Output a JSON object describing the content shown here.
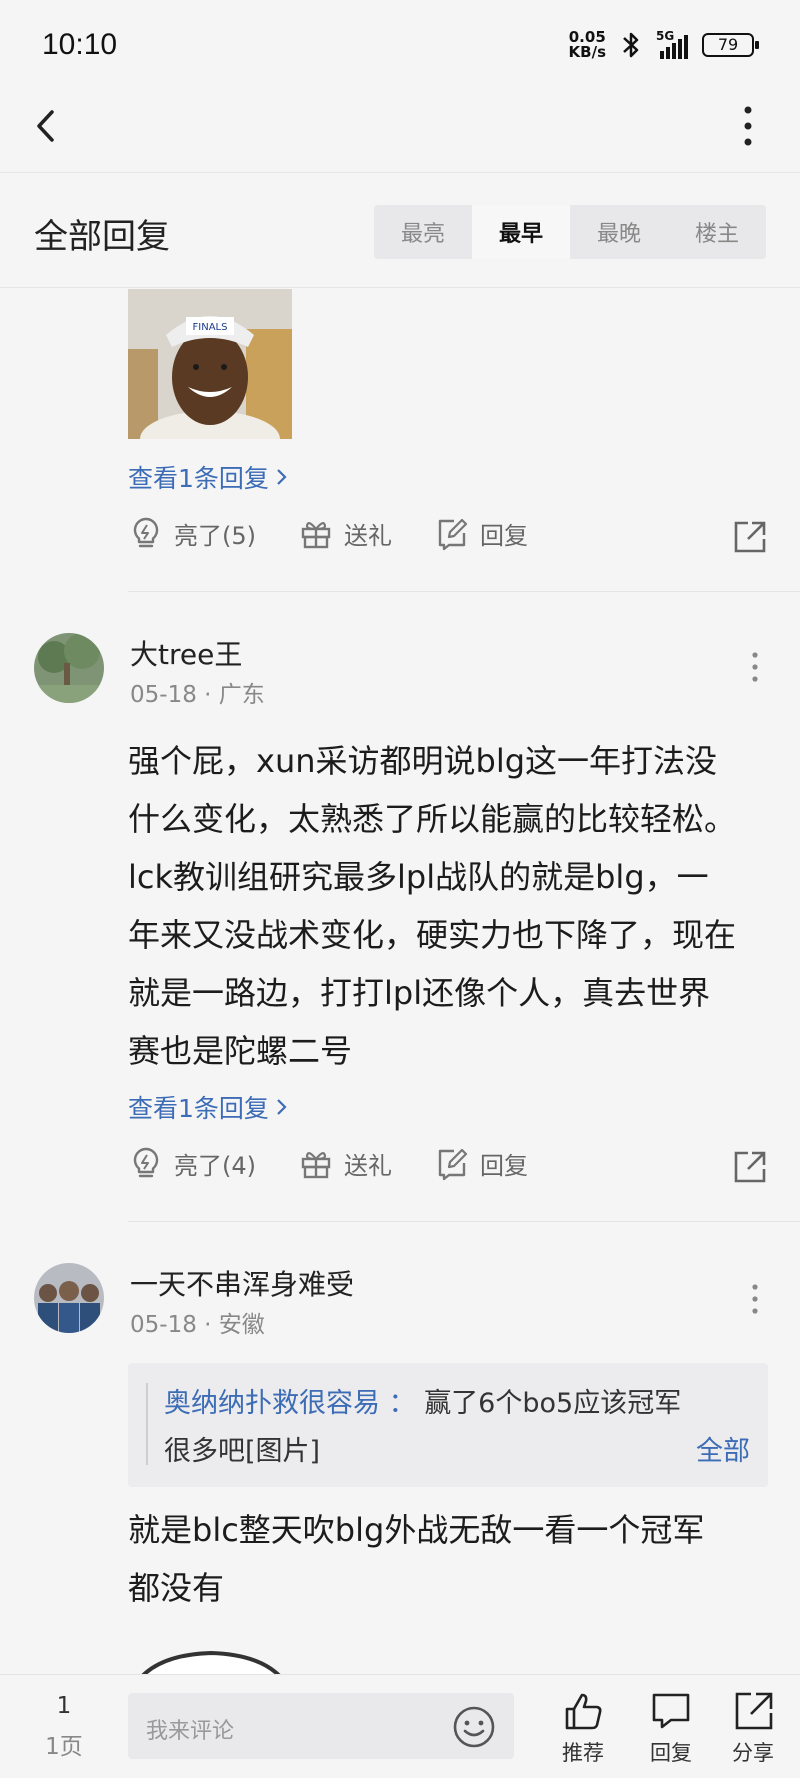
{
  "status_bar": {
    "time": "10:10",
    "net_speed_value": "0.05",
    "net_speed_unit": "KB/s",
    "network": "5G",
    "battery": "79"
  },
  "nav": {
    "back_icon": "chevron-left-icon",
    "more_icon": "more-vertical-icon"
  },
  "replies_header": {
    "title": "全部回复",
    "sort_tabs": [
      {
        "label": "最亮",
        "active": false
      },
      {
        "label": "最早",
        "active": true
      },
      {
        "label": "最晚",
        "active": false
      },
      {
        "label": "楼主",
        "active": false
      }
    ]
  },
  "first_post_tail": {
    "see_replies": "查看1条回复",
    "actions": {
      "like": "亮了(5)",
      "gift": "送礼",
      "reply": "回复"
    }
  },
  "comments": [
    {
      "username": "大tree王",
      "date": "05-18",
      "location": "广东",
      "lines": [
        "强个屁，xun采访都明说blg这一年打法没",
        "什么变化，太熟悉了所以能赢的比较轻松。",
        "lck教训组研究最多lpl战队的就是blg，一",
        "年来又没战术变化，硬实力也下降了，现在",
        "就是一路边，打打lpl还像个人，真去世界",
        "赛也是陀螺二号"
      ],
      "see_replies": "查看1条回复",
      "actions": {
        "like": "亮了(4)",
        "gift": "送礼",
        "reply": "回复"
      }
    },
    {
      "username": "一天不串浑身难受",
      "date": "05-18",
      "location": "安徽",
      "quote": {
        "author": "奥纳纳扑救很容易 ：",
        "text_line1": "赢了6个bo5应该冠军",
        "text_line2": "很多吧[图片]",
        "expand": "全部"
      },
      "lines": [
        "就是blc整天吹blg外战无敌一看一个冠军",
        "都没有"
      ]
    }
  ],
  "bottom_bar": {
    "page_number": "1",
    "page_label": "1页",
    "comment_placeholder": "我来评论",
    "recommend": "推荐",
    "reply": "回复",
    "share": "分享"
  },
  "colors": {
    "link_blue": "#3d6cb6",
    "background": "#f5f5f6"
  }
}
